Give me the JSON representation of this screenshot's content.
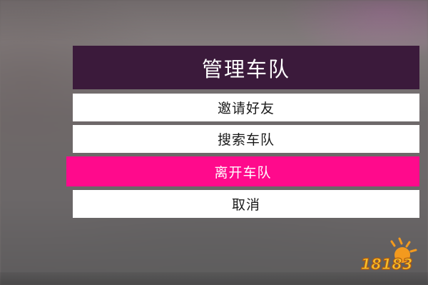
{
  "menu": {
    "title": "管理车队",
    "items": [
      {
        "label": "邀请好友",
        "selected": false
      },
      {
        "label": "搜索车队",
        "selected": false
      },
      {
        "label": "离开车队",
        "selected": true
      },
      {
        "label": "取消",
        "selected": false
      }
    ]
  },
  "colors": {
    "header_bg": "#3b1a3b",
    "item_bg": "#ffffff",
    "selected_bg": "#ff0a8c"
  },
  "watermark": {
    "text": "18183"
  }
}
